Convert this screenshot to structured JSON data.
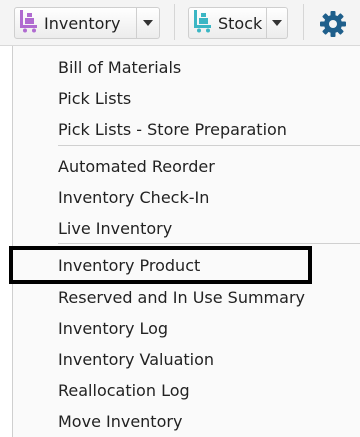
{
  "toolbar": {
    "inventory_label": "Inventory",
    "stock_label": "Stock",
    "icons": [
      "cart-icon",
      "cart-icon",
      "caret-down-icon",
      "gear-icon"
    ],
    "accent_color": "#b06bd0",
    "stock_icon_color": "#3bb6c4",
    "gear_color": "#1f5f8b"
  },
  "menu": {
    "items": [
      "Bill of Materials",
      "Pick Lists",
      "Pick Lists - Store Preparation",
      "Automated Reorder",
      "Inventory Check-In",
      "Live Inventory",
      "Inventory Product",
      "Reserved and In Use Summary",
      "Inventory Log",
      "Inventory Valuation",
      "Reallocation Log",
      "Move Inventory"
    ],
    "highlighted_item": "Inventory Product"
  }
}
